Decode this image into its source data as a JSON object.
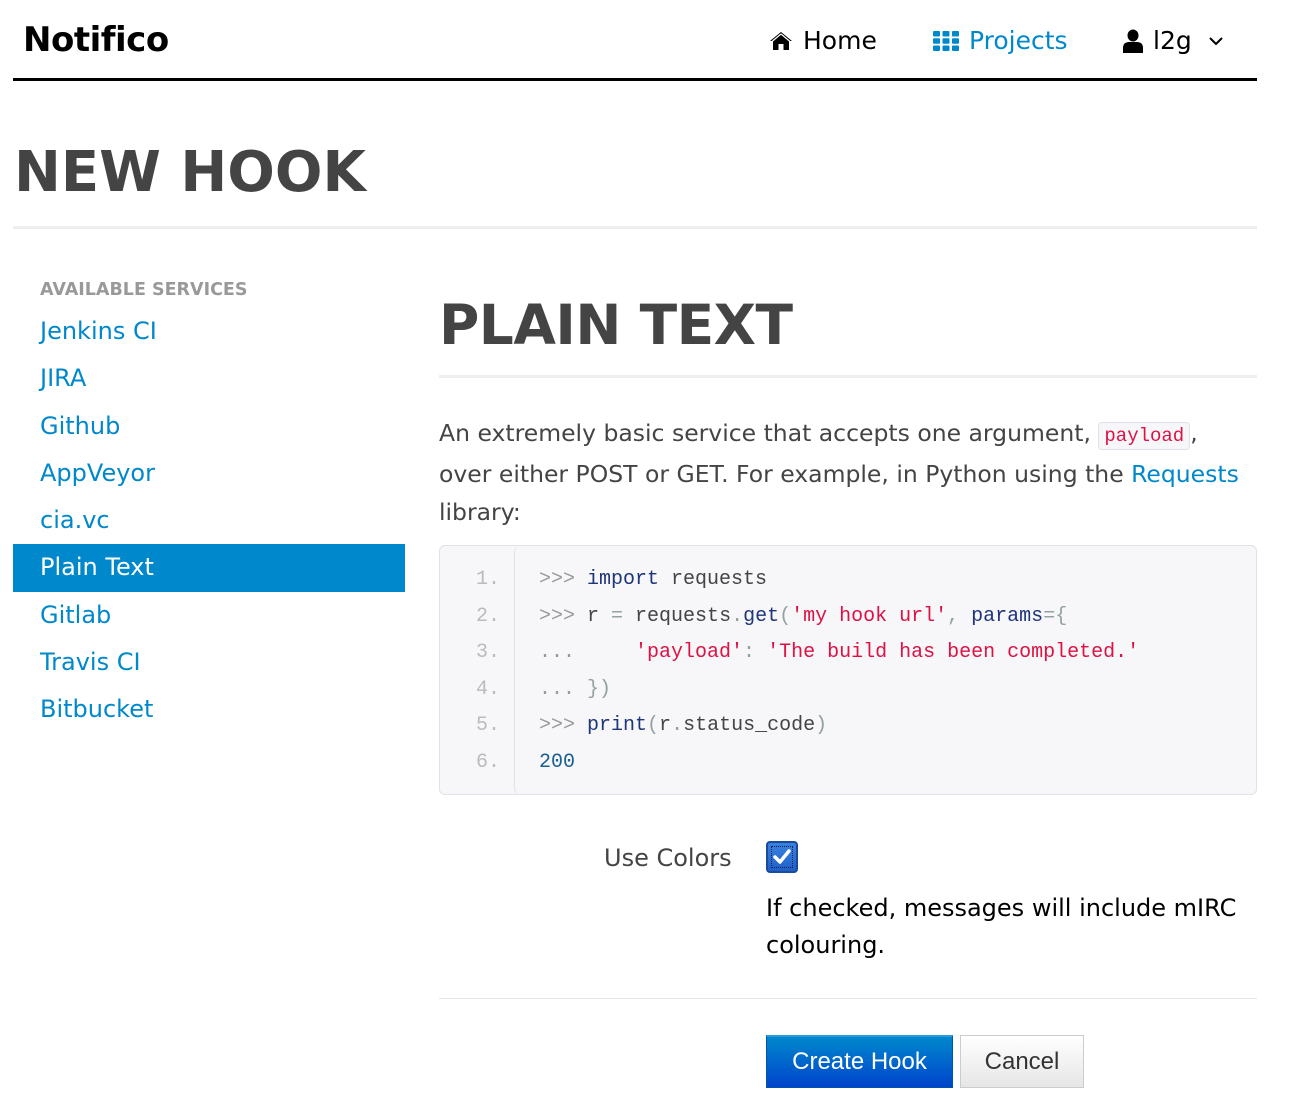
{
  "navbar": {
    "brand": "Notifico",
    "items": [
      {
        "label": "Home",
        "icon": "home-icon",
        "active": false
      },
      {
        "label": "Projects",
        "icon": "grid-icon",
        "active": true
      },
      {
        "label": "l2g",
        "icon": "user-icon",
        "dropdown": true
      }
    ]
  },
  "colors": {
    "accent": "#0088cc",
    "heading": "#444444",
    "code_string": "#dd1144",
    "code_keyword": "#1e347b",
    "code_number": "#195f91"
  },
  "page": {
    "title": "NEW HOOK"
  },
  "sidebar": {
    "header": "AVAILABLE SERVICES",
    "items": [
      {
        "label": "Jenkins CI",
        "active": false
      },
      {
        "label": "JIRA",
        "active": false
      },
      {
        "label": "Github",
        "active": false
      },
      {
        "label": "AppVeyor",
        "active": false
      },
      {
        "label": "cia.vc",
        "active": false
      },
      {
        "label": "Plain Text",
        "active": true
      },
      {
        "label": "Gitlab",
        "active": false
      },
      {
        "label": "Travis CI",
        "active": false
      },
      {
        "label": "Bitbucket",
        "active": false
      }
    ]
  },
  "main": {
    "title": "PLAIN TEXT",
    "description": {
      "part1": "An extremely basic service that accepts one argument, ",
      "code": "payload",
      "part2": ", over either POST or GET. For example, in Python using the ",
      "link": "Requests",
      "part3": " library:"
    },
    "code": {
      "line_numbers": [
        "1.",
        "2.",
        "3.",
        "4.",
        "5.",
        "6."
      ],
      "lines": [
        [
          {
            "t": "prompt",
            "v": ">>> "
          },
          {
            "t": "kw",
            "v": "import"
          },
          {
            "t": "pln",
            "v": " requests"
          }
        ],
        [
          {
            "t": "prompt",
            "v": ">>> "
          },
          {
            "t": "pln",
            "v": "r "
          },
          {
            "t": "pun",
            "v": "="
          },
          {
            "t": "pln",
            "v": " requests"
          },
          {
            "t": "pun",
            "v": "."
          },
          {
            "t": "kw",
            "v": "get"
          },
          {
            "t": "pun",
            "v": "("
          },
          {
            "t": "str",
            "v": "'my hook url'"
          },
          {
            "t": "pun",
            "v": ", "
          },
          {
            "t": "kw",
            "v": "params"
          },
          {
            "t": "pun",
            "v": "={"
          }
        ],
        [
          {
            "t": "prompt",
            "v": "...     "
          },
          {
            "t": "str",
            "v": "'payload'"
          },
          {
            "t": "pun",
            "v": ": "
          },
          {
            "t": "str",
            "v": "'The build has been completed.'"
          }
        ],
        [
          {
            "t": "prompt",
            "v": "... "
          },
          {
            "t": "pun",
            "v": "})"
          }
        ],
        [
          {
            "t": "prompt",
            "v": ">>> "
          },
          {
            "t": "kw",
            "v": "print"
          },
          {
            "t": "pun",
            "v": "("
          },
          {
            "t": "pln",
            "v": "r"
          },
          {
            "t": "pun",
            "v": "."
          },
          {
            "t": "pln",
            "v": "status_code"
          },
          {
            "t": "pun",
            "v": ")"
          }
        ],
        [
          {
            "t": "num",
            "v": "200"
          }
        ]
      ]
    },
    "form": {
      "use_colors_label": "Use Colors",
      "use_colors_checked": true,
      "use_colors_help": "If checked, messages will include mIRC colouring.",
      "submit_label": "Create Hook",
      "cancel_label": "Cancel"
    }
  }
}
